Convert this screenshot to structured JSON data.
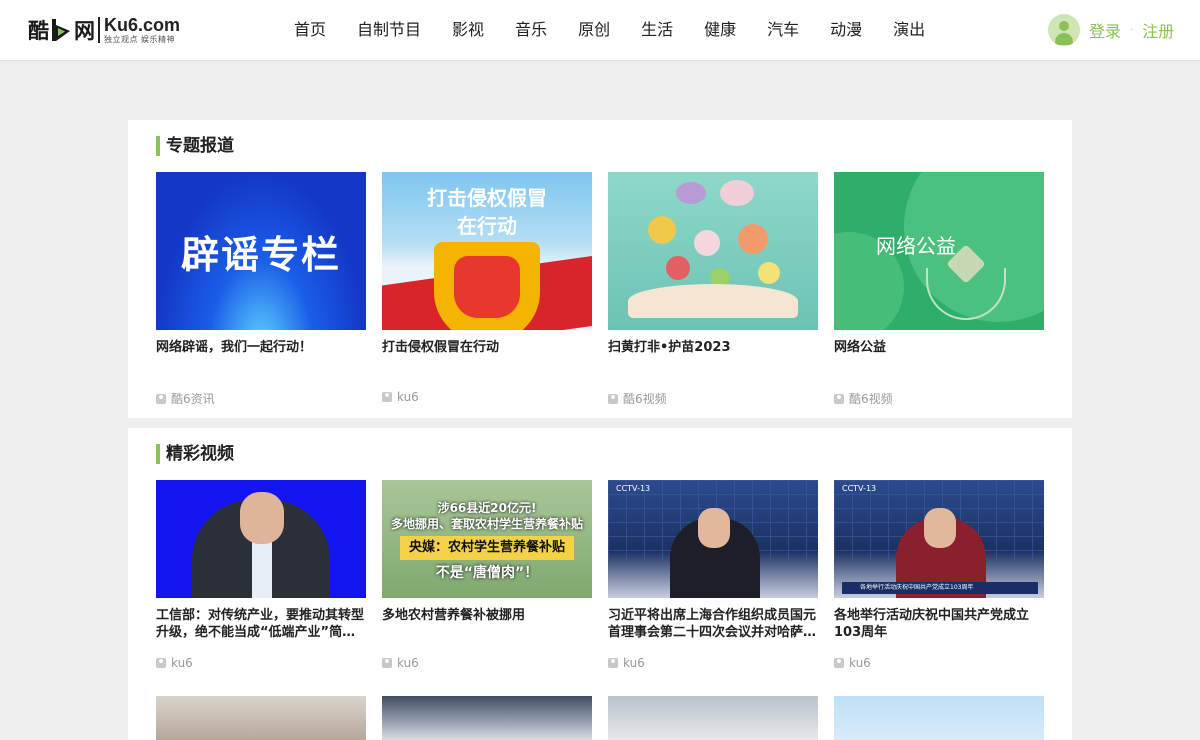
{
  "header": {
    "logo_cn": "酷",
    "logo_cn2": "网",
    "logo_en": "Ku6.com",
    "logo_slogan": "独立观点 娱乐精神",
    "nav": [
      "首页",
      "自制节目",
      "影视",
      "音乐",
      "原创",
      "生活",
      "健康",
      "汽车",
      "动漫",
      "演出"
    ],
    "login_label": "登录",
    "register_label": "注册",
    "separator": "·"
  },
  "topics": {
    "title": "专题报道",
    "items": [
      {
        "thumb_text": "辟谣专栏",
        "title": "网络辟谣，我们一起行动！",
        "author": "酷6资讯"
      },
      {
        "thumb_text": "打击侵权假冒",
        "thumb_text2": "在行动",
        "title": "打击侵权假冒在行动",
        "author": "ku6"
      },
      {
        "title": "扫黄打非•护苗2023",
        "author": "酷6视频"
      },
      {
        "thumb_text": "网络公益",
        "title": "网络公益",
        "author": "酷6视频"
      }
    ]
  },
  "videos": {
    "title": "精彩视频",
    "items": [
      {
        "title": "工信部：对传统产业，要推动其转型升级，绝不能当成“低端产业”简…",
        "author": "ku6"
      },
      {
        "thumb_text": "涉66县近20亿元!",
        "thumb_text_b": "多地挪用、套取农村学生营养餐补贴",
        "thumb_text2": "央媒：农村学生营养餐补贴",
        "thumb_text3": "不是“唐僧肉”！",
        "title": "多地农村营养餐补被挪用",
        "author": "ku6"
      },
      {
        "thumb_logo": "CCTV-13",
        "title": "习近平将出席上海合作组织成员国元首理事会第二十四次会议并对哈萨…",
        "author": "ku6"
      },
      {
        "thumb_logo": "CCTV-13",
        "thumb_caption": "各地举行活动庆祝中国共产党成立103周年",
        "title": "各地举行活动庆祝中国共产党成立103周年",
        "author": "ku6"
      }
    ]
  }
}
